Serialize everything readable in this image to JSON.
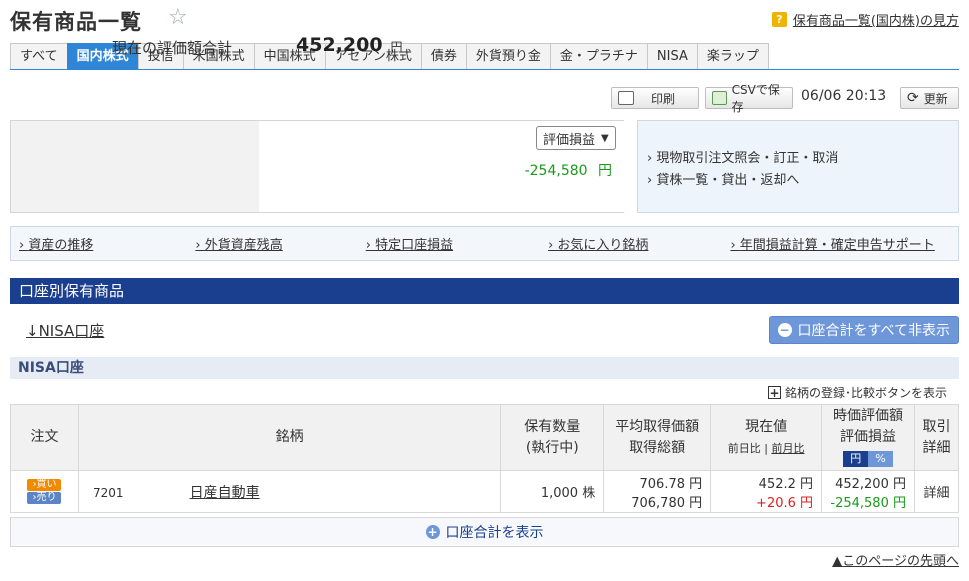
{
  "page": {
    "title": "保有商品一覧",
    "help_link": "保有商品一覧(国内株)の見方"
  },
  "tabs": [
    {
      "label": "すべて"
    },
    {
      "label": "国内株式",
      "active": true
    },
    {
      "label": "投信"
    },
    {
      "label": "米国株式"
    },
    {
      "label": "中国株式"
    },
    {
      "label": "アセアン株式"
    },
    {
      "label": "債券"
    },
    {
      "label": "外貨預り金"
    },
    {
      "label": "金・プラチナ"
    },
    {
      "label": "NISA"
    },
    {
      "label": "楽ラップ"
    }
  ],
  "toolbar": {
    "print_label": "印刷",
    "csv_label": "CSVで保存",
    "datetime": "06/06 20:13",
    "refresh_label": "更新"
  },
  "summary": {
    "total_label": "現在の評価額合計",
    "total_value": "452,200",
    "unit": "円",
    "select_value": "評価損益",
    "gain_value": "-254,580",
    "gain_unit": "円"
  },
  "side_links": [
    "現物取引注文照会・訂正・取消",
    "貸株一覧・貸出・返却へ"
  ],
  "nav_links": [
    "資産の推移",
    "外貨資産残高",
    "特定口座損益",
    "お気に入り銘柄",
    "年間損益計算・確定申告サポート"
  ],
  "section": {
    "title": "口座別保有商品",
    "nisa_link": "NISA口座",
    "hide_button": "口座合計をすべて非表示",
    "account_title": "NISA口座",
    "compare_label": "銘柄の登録･比較ボタンを表示"
  },
  "table": {
    "headers": {
      "order": "注文",
      "name": "銘柄",
      "qty1": "保有数量",
      "qty2": "(執行中)",
      "avg1": "平均取得価額",
      "avg2": "取得総額",
      "price1": "現在値",
      "price2a": "前日比",
      "price2b": "前月比",
      "eval1": "時価評価額",
      "eval2": "評価損益",
      "eval_toggle_yen": "円",
      "eval_toggle_pct": "%",
      "detail1": "取引",
      "detail2": "詳細"
    },
    "rows": [
      {
        "buy": "買い",
        "sell": "売り",
        "code": "7201",
        "name": "日産自動車",
        "qty": "1,000",
        "qty_unit": "株",
        "avg_price": "706.78",
        "avg_unit": "円",
        "total_cost": "706,780",
        "total_cost_unit": "円",
        "price": "452.2",
        "price_unit": "円",
        "change": "+20.6",
        "change_unit": "円",
        "eval": "452,200",
        "eval_unit": "円",
        "gain": "-254,580",
        "gain_unit": "円",
        "detail": "詳細"
      }
    ],
    "show_total": "口座合計を表示"
  },
  "footer": {
    "page_top": "▲このページの先頭へ"
  }
}
